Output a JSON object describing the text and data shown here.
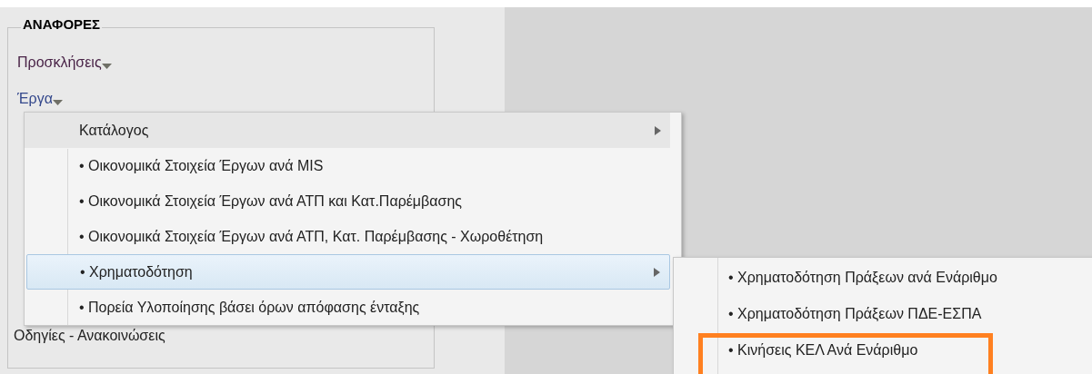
{
  "sidebar": {
    "title": "ΑΝΑΦΟΡΕΣ",
    "links": [
      {
        "label": "Προσκλήσεις",
        "color": "#4a2448"
      },
      {
        "label": "Έργα",
        "color": "#34488c"
      }
    ],
    "footer_link": "Οδηγίες - Ανακοινώσεις"
  },
  "menu": {
    "items": [
      {
        "kind": "header",
        "label": "Κατάλογος",
        "has_submenu": true,
        "selected": false
      },
      {
        "kind": "item",
        "label": "• Οικονομικά Στοιχεία Έργων ανά MIS",
        "has_submenu": false,
        "selected": false
      },
      {
        "kind": "item",
        "label": "• Οικονομικά Στοιχεία Έργων ανά ΑΤΠ και Κατ.Παρέμβασης",
        "has_submenu": false,
        "selected": false
      },
      {
        "kind": "item",
        "label": "• Οικονομικά Στοιχεία Έργων ανά ΑΤΠ, Κατ. Παρέμβασης - Χωροθέτηση",
        "has_submenu": false,
        "selected": false
      },
      {
        "kind": "item",
        "label": "• Χρηματοδότηση",
        "has_submenu": true,
        "selected": true
      },
      {
        "kind": "item",
        "label": "• Πορεία Υλοποίησης βάσει όρων απόφασης ένταξης",
        "has_submenu": false,
        "selected": false
      }
    ]
  },
  "submenu": {
    "items": [
      {
        "label": "• Χρηματοδότηση Πράξεων ανά Ενάριθμο",
        "highlighted": false
      },
      {
        "label": "• Χρηματοδότηση Πράξεων ΠΔΕ-ΕΣΠΑ",
        "highlighted": false
      },
      {
        "label": "• Κινήσεις ΚΕΛ Ανά Ενάριθμο",
        "highlighted": true
      }
    ]
  }
}
